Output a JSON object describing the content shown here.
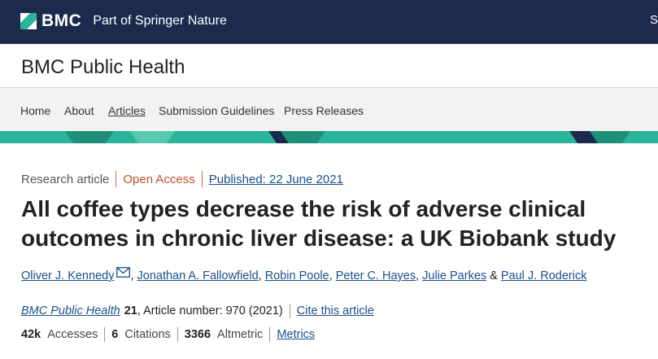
{
  "header": {
    "brand": "BMC",
    "tagline": "Part of Springer Nature",
    "edge_text": "S"
  },
  "journal": {
    "title": "BMC Public Health"
  },
  "nav": {
    "items": [
      "Home",
      "About",
      "Articles",
      "Submission Guidelines",
      "Press Releases"
    ],
    "active": "Articles"
  },
  "article": {
    "type": "Research article",
    "access": "Open Access",
    "published": "Published: 22 June 2021",
    "title": "All coffee types decrease the risk of adverse clinical outcomes in chronic liver disease: a UK Biobank study",
    "authors": [
      "Oliver J. Kennedy",
      "Jonathan A. Fallowfield",
      "Robin Poole",
      "Peter C. Hayes",
      "Julie Parkes",
      "Paul J. Roderick"
    ],
    "author_separator": ",",
    "last_separator": "&",
    "citation": {
      "journal": "BMC Public Health",
      "volume": "21",
      "rest": ", Article number: 970 (2021)",
      "cite_link": "Cite this article"
    },
    "metrics": {
      "accesses_value": "42k",
      "accesses_label": "Accesses",
      "citations_value": "6",
      "citations_label": "Citations",
      "altmetric_value": "3366",
      "altmetric_label": "Altmetric",
      "metrics_link": "Metrics"
    }
  },
  "colors": {
    "header_bg": "#1c2a4e",
    "accent_teal": "#2ab59a",
    "link": "#1a4f8a",
    "open_access": "#c0502b"
  },
  "icons": [
    "bmc-logo-icon",
    "mail-icon"
  ]
}
